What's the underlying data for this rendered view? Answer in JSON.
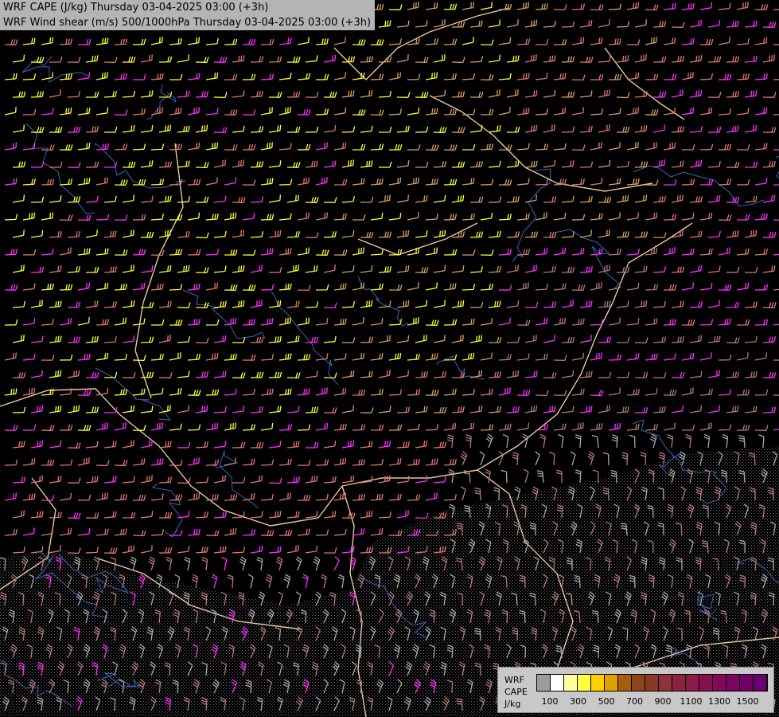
{
  "title": {
    "line1": "WRF CAPE (J/kg) Thursday 03-04-2025 03:00 (+3h)",
    "line2": "WRF Wind shear (m/s) 500/1000hPa Thursday 03-04-2025 03:00 (+3h)"
  },
  "legend": {
    "model": "WRF",
    "variable": "CAPE",
    "unit": "J/kg",
    "tick_labels": [
      "100",
      "300",
      "500",
      "700",
      "900",
      "1100",
      "1300",
      "1500"
    ],
    "colors": [
      "#9c9c9c",
      "#ffffff",
      "#ffffa0",
      "#ffff40",
      "#ffd000",
      "#e0a000",
      "#a85c10",
      "#8c4618",
      "#8a3a22",
      "#90303a",
      "#8c2440",
      "#8a1a48",
      "#86104e",
      "#800a58",
      "#7a0460",
      "#700068",
      "#6a006e"
    ]
  },
  "colors": {
    "background": "#000000",
    "border": "#e8c8a0",
    "river": "#3c64b4",
    "barb_yellow": "#ffff30",
    "barb_tan": "#d8a060",
    "barb_salmon": "#e07870",
    "barb_magenta": "#ff30ff",
    "barb_dusty": "#b87878",
    "barb_grey": "#a8a8a8",
    "terrain": "#808080"
  }
}
